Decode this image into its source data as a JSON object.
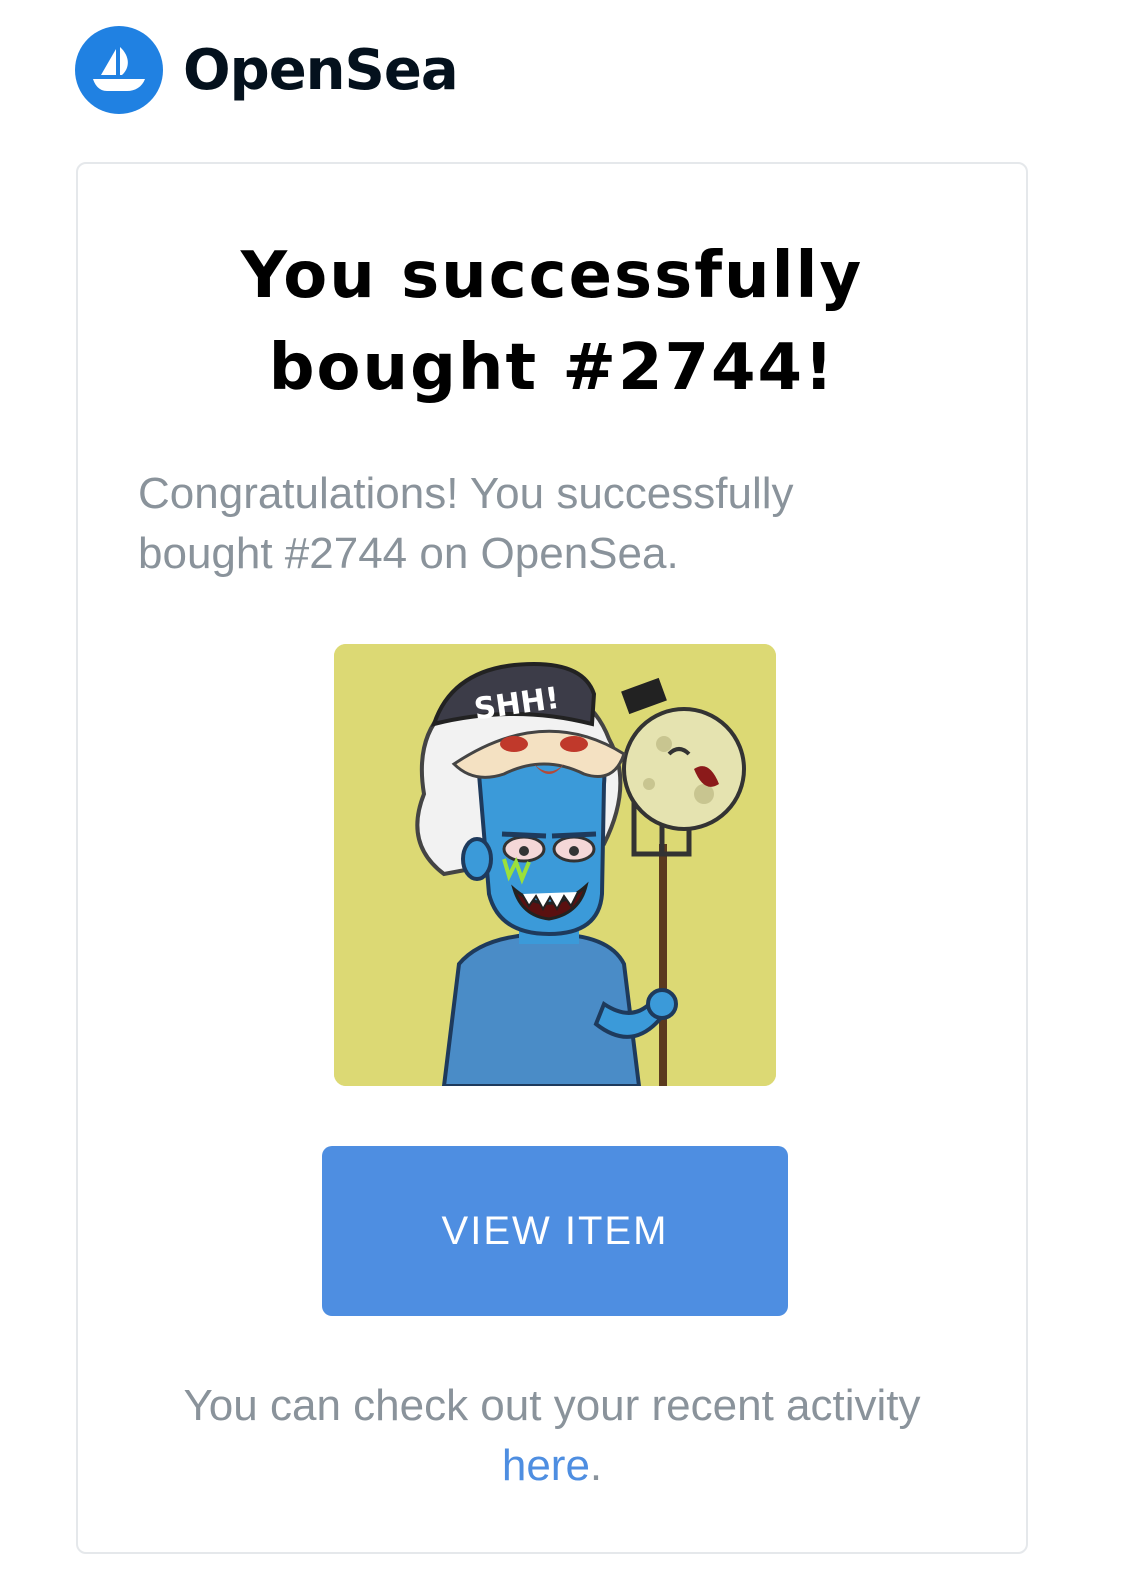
{
  "brand": {
    "name": "OpenSea",
    "logo_icon": "opensea-ship-icon",
    "logo_color": "#2081E2"
  },
  "card": {
    "headline_line1": "You successfully",
    "headline_line2": "bought #2744!",
    "message_line1": "Congratulations! You successfully",
    "message_line2": "bought #2744 on OpenSea.",
    "nft_image": {
      "subject": "nft-artwork",
      "background_color": "#DCD974",
      "cap_text": "SHH!"
    },
    "button": {
      "label": "VIEW ITEM",
      "color": "#4E8EE1"
    },
    "footer": {
      "text": "You can check out your recent activity",
      "link_text": "here",
      "suffix": ".",
      "link_color": "#4E8EE1"
    }
  }
}
